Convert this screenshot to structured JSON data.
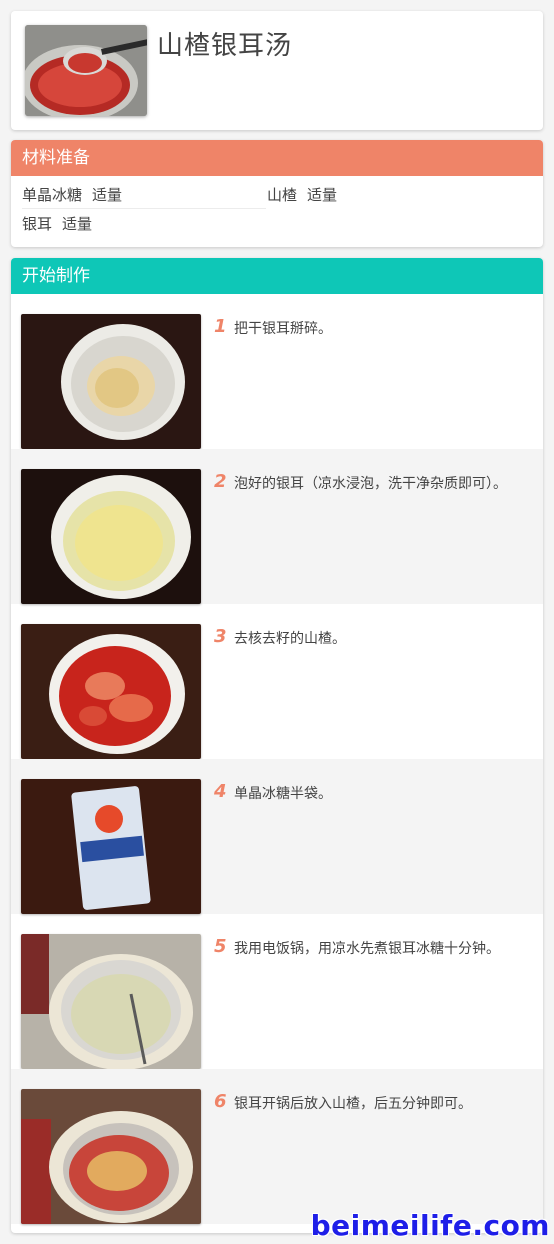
{
  "recipe": {
    "title": "山楂银耳汤"
  },
  "ingredients": {
    "header": "材料准备",
    "items": [
      {
        "name": "单晶冰糖",
        "qty": "适量"
      },
      {
        "name": "山楂",
        "qty": "适量"
      },
      {
        "name": "银耳",
        "qty": "适量"
      }
    ]
  },
  "steps": {
    "header": "开始制作",
    "items": [
      {
        "num": "1",
        "text": "把干银耳掰碎。"
      },
      {
        "num": "2",
        "text": "泡好的银耳（凉水浸泡，洗干净杂质即可）。"
      },
      {
        "num": "3",
        "text": "去核去籽的山楂。"
      },
      {
        "num": "4",
        "text": "单晶冰糖半袋。"
      },
      {
        "num": "5",
        "text": "我用电饭锅，用凉水先煮银耳冰糖十分钟。"
      },
      {
        "num": "6",
        "text": "银耳开锅后放入山楂，后五分钟即可。"
      }
    ]
  },
  "watermark": "beimeilife.com",
  "colors": {
    "ingredients_header": "#ef8468",
    "steps_header": "#0ec7b7",
    "step_number": "#ef8468",
    "watermark": "#1e1ee8"
  }
}
